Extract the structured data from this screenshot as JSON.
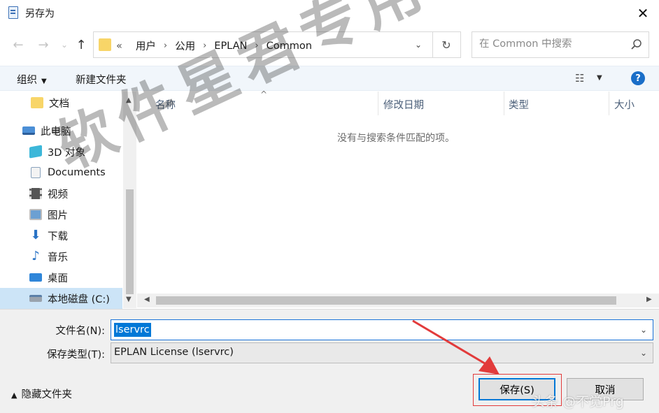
{
  "window": {
    "title": "另存为",
    "close_glyph": "✕"
  },
  "nav_buttons": {
    "back": "←",
    "forward": "→",
    "recent": "⌄",
    "up": "↑"
  },
  "address": {
    "overflow": "«",
    "crumbs": [
      "用户",
      "公用",
      "EPLAN",
      "Common"
    ],
    "dropdown_glyph": "⌄",
    "refresh_glyph": "↻"
  },
  "search": {
    "placeholder": "在 Common 中搜索",
    "icon": "search-icon"
  },
  "toolbar": {
    "organize_label": "组织",
    "new_folder_label": "新建文件夹",
    "view_glyph": "☷",
    "help_glyph": "?"
  },
  "sidebar": {
    "items": [
      {
        "label": "文档",
        "icon": "folder-icon"
      },
      {
        "label": "此电脑",
        "icon": "pc-icon"
      },
      {
        "label": "3D 对象",
        "icon": "3d-objects-icon"
      },
      {
        "label": "Documents",
        "icon": "document-icon"
      },
      {
        "label": "视频",
        "icon": "video-icon"
      },
      {
        "label": "图片",
        "icon": "picture-icon"
      },
      {
        "label": "下载",
        "icon": "download-icon"
      },
      {
        "label": "音乐",
        "icon": "music-icon"
      },
      {
        "label": "桌面",
        "icon": "desktop-icon"
      },
      {
        "label": "本地磁盘 (C:)",
        "icon": "disk-icon"
      }
    ]
  },
  "columns": {
    "name": "名称",
    "modified": "修改日期",
    "type": "类型",
    "size": "大小"
  },
  "empty_message": "没有与搜索条件匹配的项。",
  "form": {
    "filename_label": "文件名(N):",
    "filename_value": "lservrc",
    "filetype_label": "保存类型(T):",
    "filetype_value": "EPLAN License (lservrc)"
  },
  "footer": {
    "hide_folders_label": "隐藏文件夹",
    "save_label": "保存(S)",
    "cancel_label": "取消"
  },
  "watermark_text": "软件星君专用",
  "corner_mark_text": "头条 @不觉Prg",
  "colors": {
    "accent": "#0078d7",
    "annotation_red": "#e23b3b",
    "toolbar_bg": "#f1f6fb",
    "selected_bg": "#cce4f7"
  }
}
